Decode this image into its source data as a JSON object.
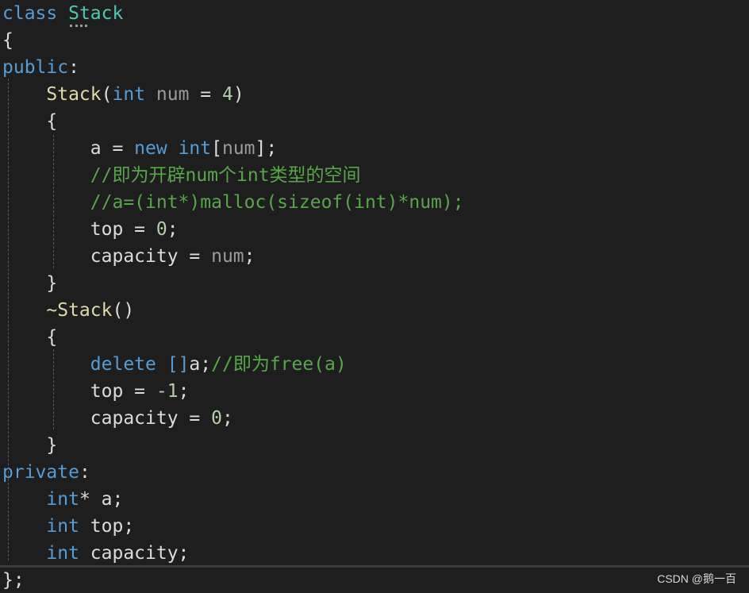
{
  "editor": {
    "lines": [
      [
        {
          "t": "class ",
          "c": "kw"
        },
        {
          "t": "Stack",
          "c": "type"
        }
      ],
      [
        {
          "t": "{",
          "c": "txt"
        }
      ],
      [
        {
          "t": "public",
          "c": "kw"
        },
        {
          "t": ":",
          "c": "txt"
        }
      ],
      [
        {
          "t": "    ",
          "c": "txt"
        },
        {
          "t": "Stack",
          "c": "fn"
        },
        {
          "t": "(",
          "c": "txt"
        },
        {
          "t": "int",
          "c": "kw"
        },
        {
          "t": " num",
          "c": "param"
        },
        {
          "t": " = ",
          "c": "txt"
        },
        {
          "t": "4",
          "c": "num"
        },
        {
          "t": ")",
          "c": "txt"
        }
      ],
      [
        {
          "t": "    {",
          "c": "txt"
        }
      ],
      [
        {
          "t": "        a = ",
          "c": "txt"
        },
        {
          "t": "new ",
          "c": "kw"
        },
        {
          "t": "int",
          "c": "kw"
        },
        {
          "t": "[",
          "c": "txt"
        },
        {
          "t": "num",
          "c": "param"
        },
        {
          "t": "];",
          "c": "txt"
        }
      ],
      [
        {
          "t": "        ",
          "c": "txt"
        },
        {
          "t": "//即为开辟num个int类型的空间",
          "c": "cm"
        }
      ],
      [
        {
          "t": "        ",
          "c": "txt"
        },
        {
          "t": "//a=(int*)malloc(sizeof(int)*num);",
          "c": "cm"
        }
      ],
      [
        {
          "t": "        top = ",
          "c": "txt"
        },
        {
          "t": "0",
          "c": "num"
        },
        {
          "t": ";",
          "c": "txt"
        }
      ],
      [
        {
          "t": "        capacity = ",
          "c": "txt"
        },
        {
          "t": "num",
          "c": "param"
        },
        {
          "t": ";",
          "c": "txt"
        }
      ],
      [
        {
          "t": "    }",
          "c": "txt"
        }
      ],
      [
        {
          "t": "    ",
          "c": "txt"
        },
        {
          "t": "~Stack",
          "c": "fn"
        },
        {
          "t": "()",
          "c": "txt"
        }
      ],
      [
        {
          "t": "    {",
          "c": "txt"
        }
      ],
      [
        {
          "t": "        ",
          "c": "txt"
        },
        {
          "t": "delete ",
          "c": "kw"
        },
        {
          "t": "[]",
          "c": "kw"
        },
        {
          "t": "a;",
          "c": "txt"
        },
        {
          "t": "//即为free(a)",
          "c": "cm"
        }
      ],
      [
        {
          "t": "        top = ",
          "c": "txt"
        },
        {
          "t": "-1",
          "c": "num"
        },
        {
          "t": ";",
          "c": "txt"
        }
      ],
      [
        {
          "t": "        capacity = ",
          "c": "txt"
        },
        {
          "t": "0",
          "c": "num"
        },
        {
          "t": ";",
          "c": "txt"
        }
      ],
      [
        {
          "t": "    }",
          "c": "txt"
        }
      ],
      [
        {
          "t": "private",
          "c": "kw"
        },
        {
          "t": ":",
          "c": "txt"
        }
      ],
      [
        {
          "t": "    ",
          "c": "txt"
        },
        {
          "t": "int",
          "c": "kw"
        },
        {
          "t": "* a;",
          "c": "txt"
        }
      ],
      [
        {
          "t": "    ",
          "c": "txt"
        },
        {
          "t": "int",
          "c": "kw"
        },
        {
          "t": " top;",
          "c": "txt"
        }
      ],
      [
        {
          "t": "    ",
          "c": "txt"
        },
        {
          "t": "int",
          "c": "kw"
        },
        {
          "t": " capacity;",
          "c": "txt"
        }
      ],
      [
        {
          "t": "};",
          "c": "txt"
        }
      ]
    ]
  },
  "watermark": "CSDN @鹅一百",
  "colors": {
    "background": "#1e1e1e",
    "keyword": "#569cd6",
    "type": "#4ec9b0",
    "function": "#dcdcaa",
    "comment": "#57a64a",
    "number": "#b5cea8",
    "text": "#dcdcdc",
    "parameter": "#9a9a9a"
  }
}
